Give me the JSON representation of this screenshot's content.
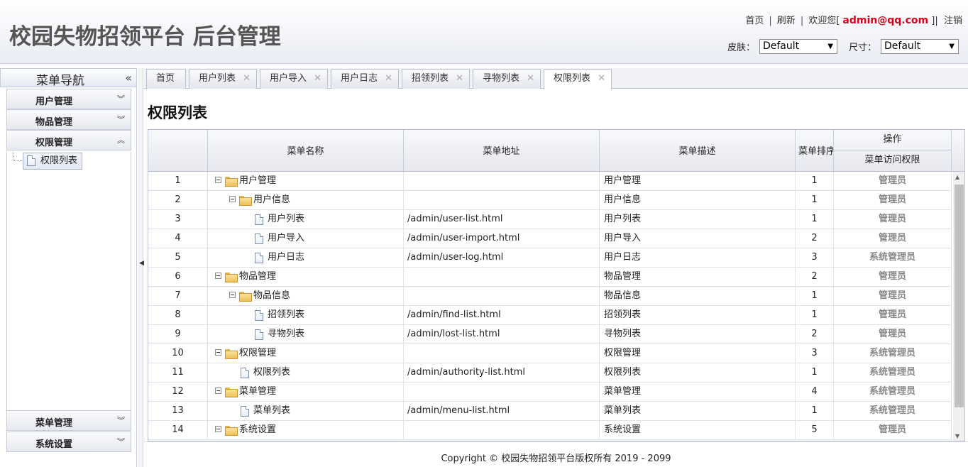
{
  "header": {
    "title": "校园失物招领平台 后台管理",
    "links": {
      "home": "首页",
      "sep1": "|",
      "refresh": "刷新",
      "sep2": "|",
      "welcome_prefix": "欢迎您[",
      "user": "admin@qq.com",
      "welcome_suffix": "]|",
      "logout": "注销"
    },
    "skin_label": "皮肤：",
    "skin_value": "Default",
    "size_label": "尺寸：",
    "size_value": "Default"
  },
  "sidebar": {
    "title": "菜单导航",
    "collapse_glyph": "«",
    "panels": [
      {
        "label": "用户管理",
        "expanded": false
      },
      {
        "label": "物品管理",
        "expanded": false
      },
      {
        "label": "权限管理",
        "expanded": true
      },
      {
        "label": "菜单管理",
        "expanded": false
      },
      {
        "label": "系统设置",
        "expanded": false
      }
    ],
    "active_item": "权限列表"
  },
  "tabs": [
    {
      "label": "首页",
      "closable": false
    },
    {
      "label": "用户列表",
      "closable": true
    },
    {
      "label": "用户导入",
      "closable": true
    },
    {
      "label": "用户日志",
      "closable": true
    },
    {
      "label": "招领列表",
      "closable": true
    },
    {
      "label": "寻物列表",
      "closable": true
    },
    {
      "label": "权限列表",
      "closable": true,
      "active": true
    }
  ],
  "page_title": "权限列表",
  "grid": {
    "columns": {
      "name": "菜单名称",
      "url": "菜单地址",
      "desc": "菜单描述",
      "sort": "菜单排序",
      "op": "操作",
      "op_sub": "菜单访问权限"
    },
    "rows": [
      {
        "no": "1",
        "level": 0,
        "type": "folder",
        "name": "用户管理",
        "url": "",
        "desc": "用户管理",
        "sort": "1",
        "role": "管理员"
      },
      {
        "no": "2",
        "level": 1,
        "type": "folder",
        "name": "用户信息",
        "url": "",
        "desc": "用户信息",
        "sort": "1",
        "role": "管理员"
      },
      {
        "no": "3",
        "level": 2,
        "type": "file",
        "name": "用户列表",
        "url": "/admin/user-list.html",
        "desc": "用户列表",
        "sort": "1",
        "role": "管理员"
      },
      {
        "no": "4",
        "level": 2,
        "type": "file",
        "name": "用户导入",
        "url": "/admin/user-import.html",
        "desc": "用户导入",
        "sort": "2",
        "role": "管理员"
      },
      {
        "no": "5",
        "level": 2,
        "type": "file",
        "name": "用户日志",
        "url": "/admin/user-log.html",
        "desc": "用户日志",
        "sort": "3",
        "role": "系统管理员"
      },
      {
        "no": "6",
        "level": 0,
        "type": "folder",
        "name": "物品管理",
        "url": "",
        "desc": "物品管理",
        "sort": "2",
        "role": "管理员"
      },
      {
        "no": "7",
        "level": 1,
        "type": "folder",
        "name": "物品信息",
        "url": "",
        "desc": "物品信息",
        "sort": "1",
        "role": "管理员"
      },
      {
        "no": "8",
        "level": 2,
        "type": "file",
        "name": "招领列表",
        "url": "/admin/find-list.html",
        "desc": "招领列表",
        "sort": "1",
        "role": "管理员"
      },
      {
        "no": "9",
        "level": 2,
        "type": "file",
        "name": "寻物列表",
        "url": "/admin/lost-list.html",
        "desc": "寻物列表",
        "sort": "2",
        "role": "管理员"
      },
      {
        "no": "10",
        "level": 0,
        "type": "folder",
        "name": "权限管理",
        "url": "",
        "desc": "权限管理",
        "sort": "3",
        "role": "系统管理员"
      },
      {
        "no": "11",
        "level": 1,
        "type": "file",
        "name": "权限列表",
        "url": "/admin/authority-list.html",
        "desc": "权限列表",
        "sort": "1",
        "role": "系统管理员"
      },
      {
        "no": "12",
        "level": 0,
        "type": "folder",
        "name": "菜单管理",
        "url": "",
        "desc": "菜单管理",
        "sort": "4",
        "role": "系统管理员"
      },
      {
        "no": "13",
        "level": 1,
        "type": "file",
        "name": "菜单列表",
        "url": "/admin/menu-list.html",
        "desc": "菜单列表",
        "sort": "1",
        "role": "系统管理员"
      },
      {
        "no": "14",
        "level": 0,
        "type": "folder",
        "name": "系统设置",
        "url": "",
        "desc": "系统设置",
        "sort": "5",
        "role": "管理员"
      }
    ]
  },
  "footer": "Copyright © 校园失物招领平台版权所有  2019 - 2099"
}
